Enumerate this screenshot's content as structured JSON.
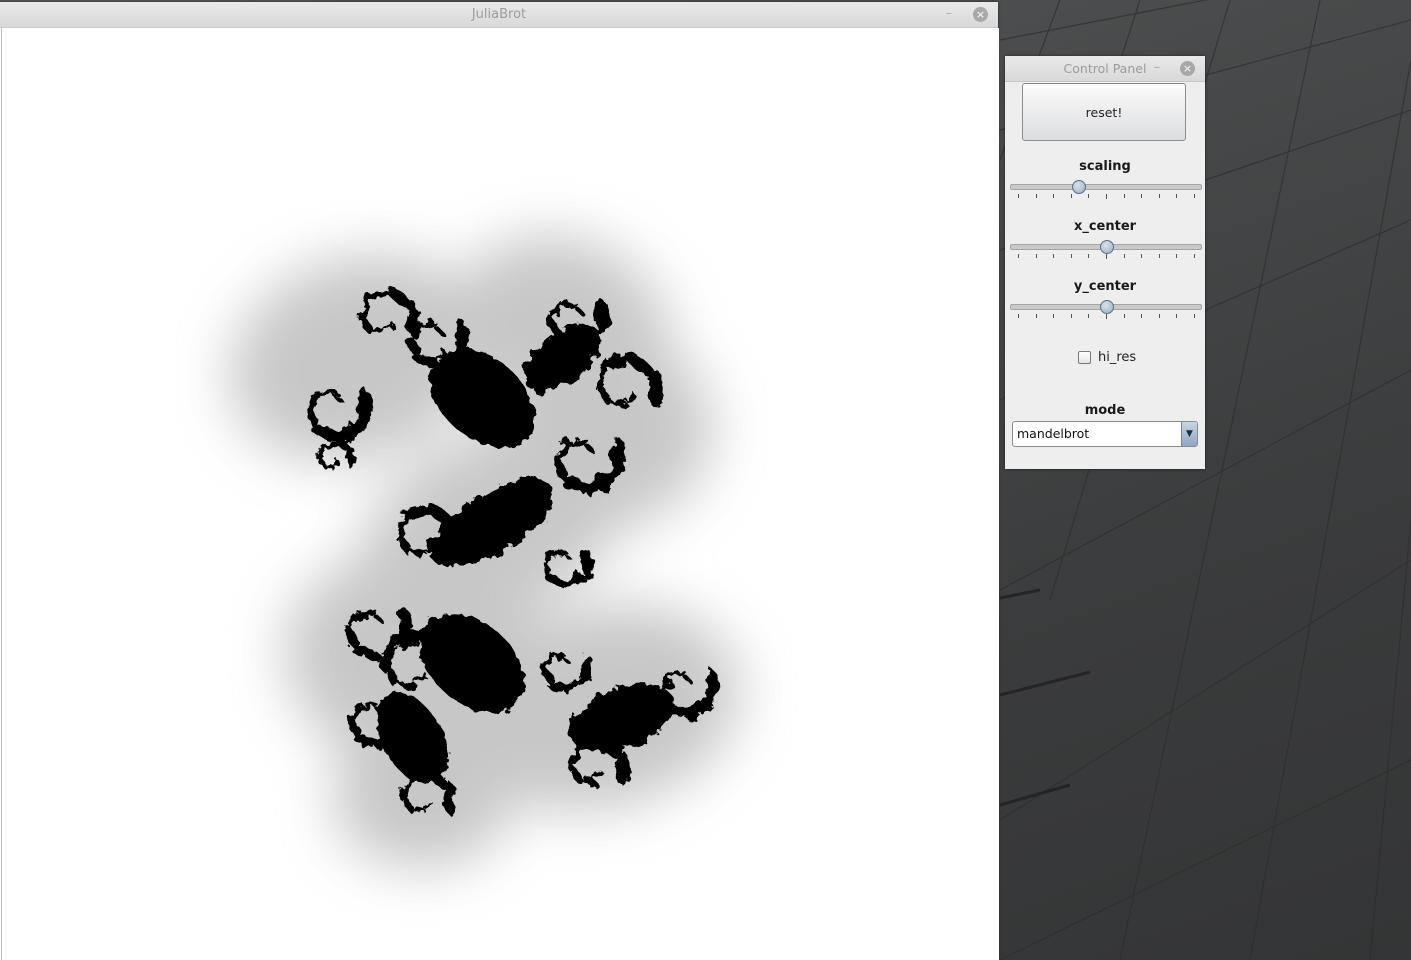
{
  "main_window": {
    "title": "JuliaBrot",
    "minimize_glyph": "–",
    "close_glyph": "×"
  },
  "control_panel": {
    "title": "Control Panel",
    "minimize_glyph": "–",
    "close_glyph": "×",
    "reset_label": "reset!",
    "sliders": [
      {
        "label": "scaling",
        "value_fraction": 0.35
      },
      {
        "label": "x_center",
        "value_fraction": 0.5
      },
      {
        "label": "y_center",
        "value_fraction": 0.5
      }
    ],
    "hi_res": {
      "label": "hi_res",
      "checked": false
    },
    "mode": {
      "label": "mode",
      "selected": "mandelbrot"
    }
  },
  "icons": {
    "minimize": "minimize-icon",
    "close": "close-icon",
    "dropdown": "chevron-down-icon"
  },
  "colors": {
    "fractal": "#000000",
    "canvas_background": "#ffffff",
    "panel_background": "#eeeeee",
    "slider_thumb": "#9aabbd"
  }
}
